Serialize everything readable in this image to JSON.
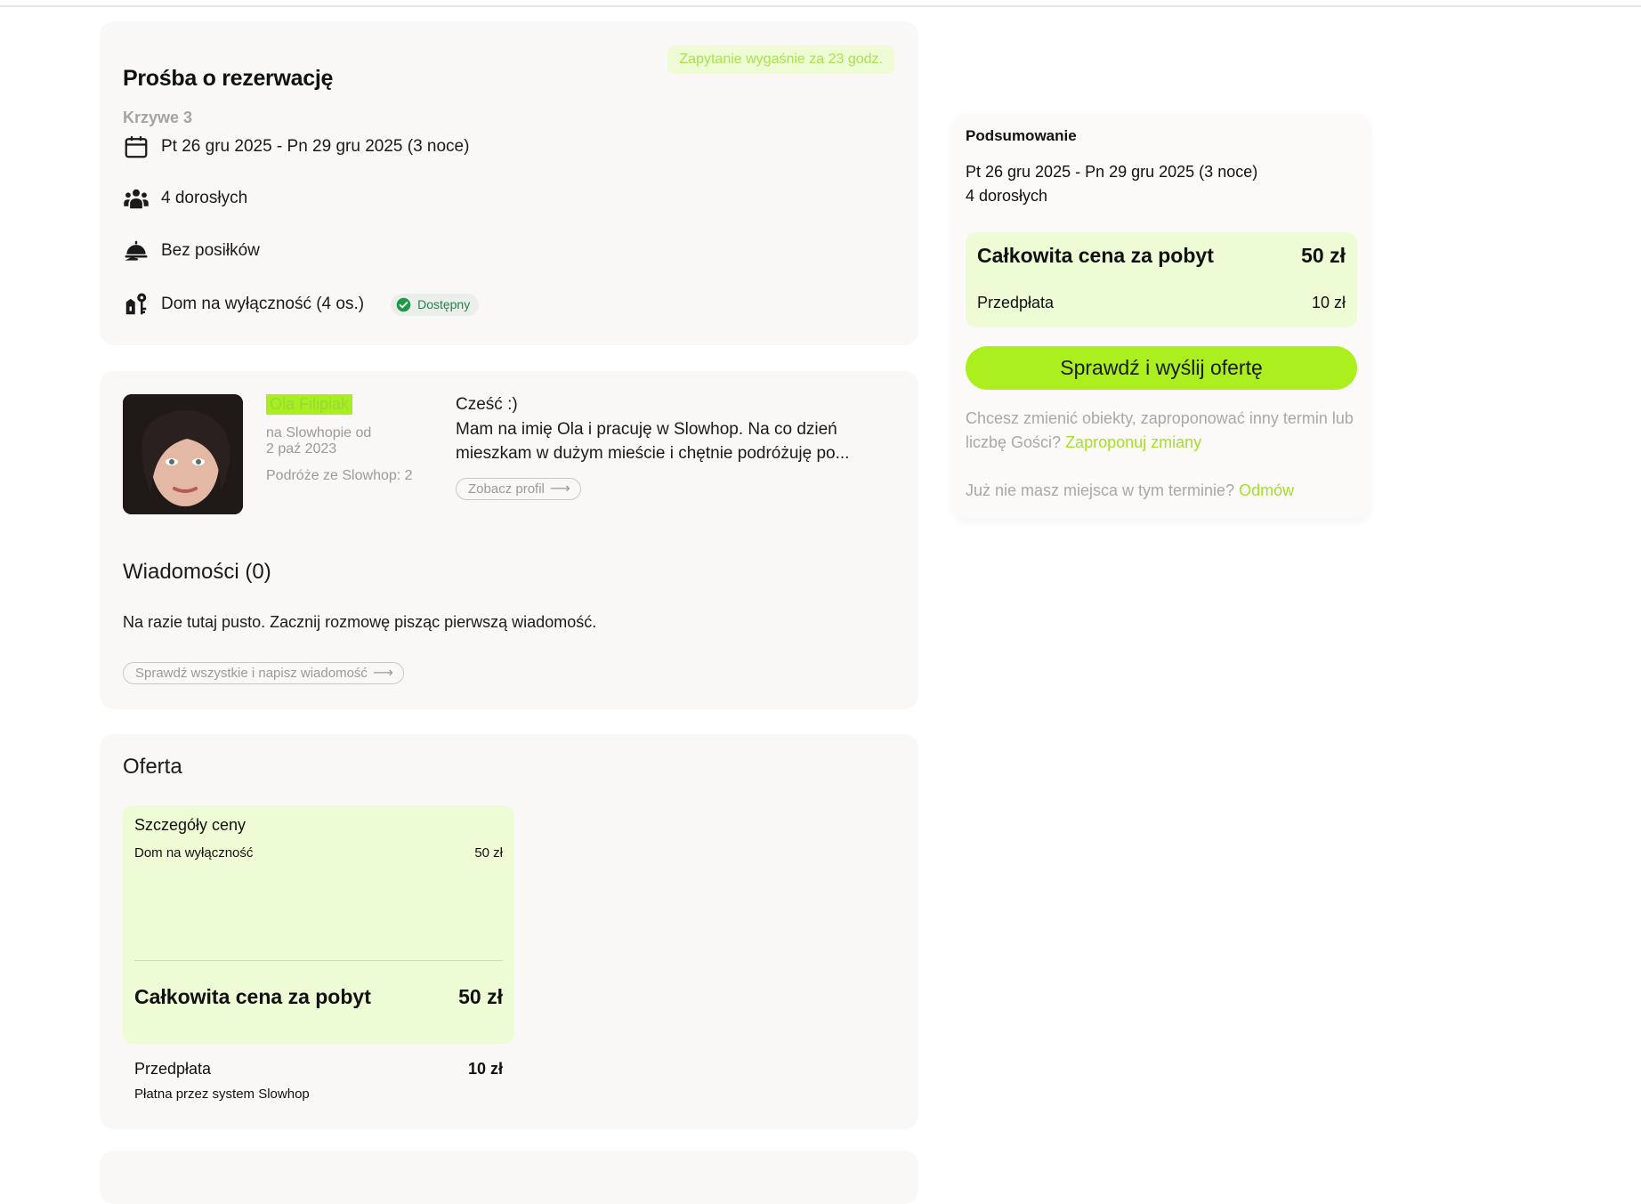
{
  "request": {
    "title": "Prośba o rezerwację",
    "expiry_badge": "Zapytanie wygaśnie za 23 godz.",
    "property_name": "Krzywe 3",
    "dates": "Pt 26 gru 2025 - Pn 29 gru 2025 (3 noce)",
    "guests": "4 dorosłych",
    "meals": "Bez posiłków",
    "house": "Dom na wyłączność  (4 os.)",
    "availability": "Dostępny",
    "icons": [
      "calendar-icon",
      "people-icon",
      "meal-icon",
      "key-icon",
      "check-circle-icon"
    ]
  },
  "guest": {
    "name": "Ola Filipiak",
    "member_since_label": "na Slowhopie od",
    "member_since_date": "2 paź 2023",
    "trips": "Podróże ze Slowhop: 2",
    "greeting": "Cześć :)",
    "intro": "Mam na imię Ola i pracuję w Slowhop. Na co dzień mieszkam w dużym mieście i chętnie podróżuję po...",
    "profile_link": "Zobacz profil"
  },
  "messages": {
    "heading": "Wiadomości (0)",
    "empty_text": "Na razie tutaj pusto. Zacznij rozmowę pisząc pierwszą wiadomość.",
    "link": "Sprawdź wszystkie i napisz wiadomość"
  },
  "offer": {
    "heading": "Oferta",
    "price_details_label": "Szczegóły ceny",
    "item_label": "Dom na wyłączność",
    "item_value": "50 zł",
    "total_label": "Całkowita cena za pobyt",
    "total_value": "50 zł",
    "deposit_label": "Przedpłata",
    "deposit_value": "10 zł",
    "deposit_note": "Płatna przez system Slowhop"
  },
  "summary": {
    "heading": "Podsumowanie",
    "dates": "Pt 26 gru 2025 - Pn 29 gru 2025 (3 noce)",
    "guests": "4 dorosłych",
    "total_label": "Całkowita cena za pobyt",
    "total_value": "50 zł",
    "deposit_label": "Przedpłata",
    "deposit_value": "10 zł",
    "cta": "Sprawdź i wyślij ofertę",
    "change_text": "Chcesz zmienić obiekty, zaproponować inny termin lub liczbę Gości?",
    "change_link": "Zaproponuj zmiany",
    "decline_text": "Już nie masz miejsca w tym terminie?",
    "decline_link": "Odmów"
  },
  "colors": {
    "accent": "#abef1e",
    "accent_text": "#a3df2b",
    "light_green": "#edfcd4",
    "card_bg": "#f9f8f6",
    "available_green": "#23844a"
  }
}
